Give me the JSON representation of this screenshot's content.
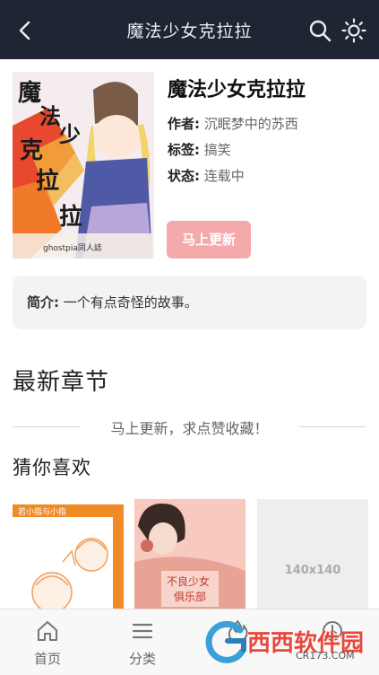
{
  "header": {
    "title": "魔法少女克拉拉",
    "back_icon": "chevron-left-icon",
    "search_icon": "search-icon",
    "theme_icon": "sun-icon"
  },
  "book": {
    "title": "魔法少女克拉拉",
    "author_key": "作者:",
    "author": "沉眠梦中的苏西",
    "tag_key": "标签:",
    "tag": "搞笑",
    "status_key": "状态:",
    "status": "连载中",
    "cover_text": "魔法少女克拉拉",
    "cover_credit": "ghostpia同人誌",
    "update_button": "马上更新"
  },
  "intro": {
    "key": "简介:",
    "text": "一个有点奇怪的故事。"
  },
  "latest": {
    "heading": "最新章节",
    "notice": "马上更新，求点赞收藏！"
  },
  "guess": {
    "heading": "猜你喜欢",
    "items": [
      {
        "cover_title": "若小指与小指"
      },
      {
        "cover_title_line1": "不良少女",
        "cover_title_line2": "俱乐部"
      },
      {
        "placeholder": "140x140"
      }
    ]
  },
  "bottom_nav": [
    {
      "label": "首页",
      "icon": "home-icon"
    },
    {
      "label": "分类",
      "icon": "menu-icon"
    },
    {
      "label": "",
      "icon": "fire-icon"
    },
    {
      "label": "",
      "icon": "clock-icon"
    }
  ],
  "watermark": {
    "brand": "西西软件园",
    "site": "CR173.COM"
  },
  "colors": {
    "topbar": "#1f2533",
    "update_button": "#f6a9aa",
    "intro_bg": "#f2f3f5",
    "watermark": "#e8473c"
  }
}
